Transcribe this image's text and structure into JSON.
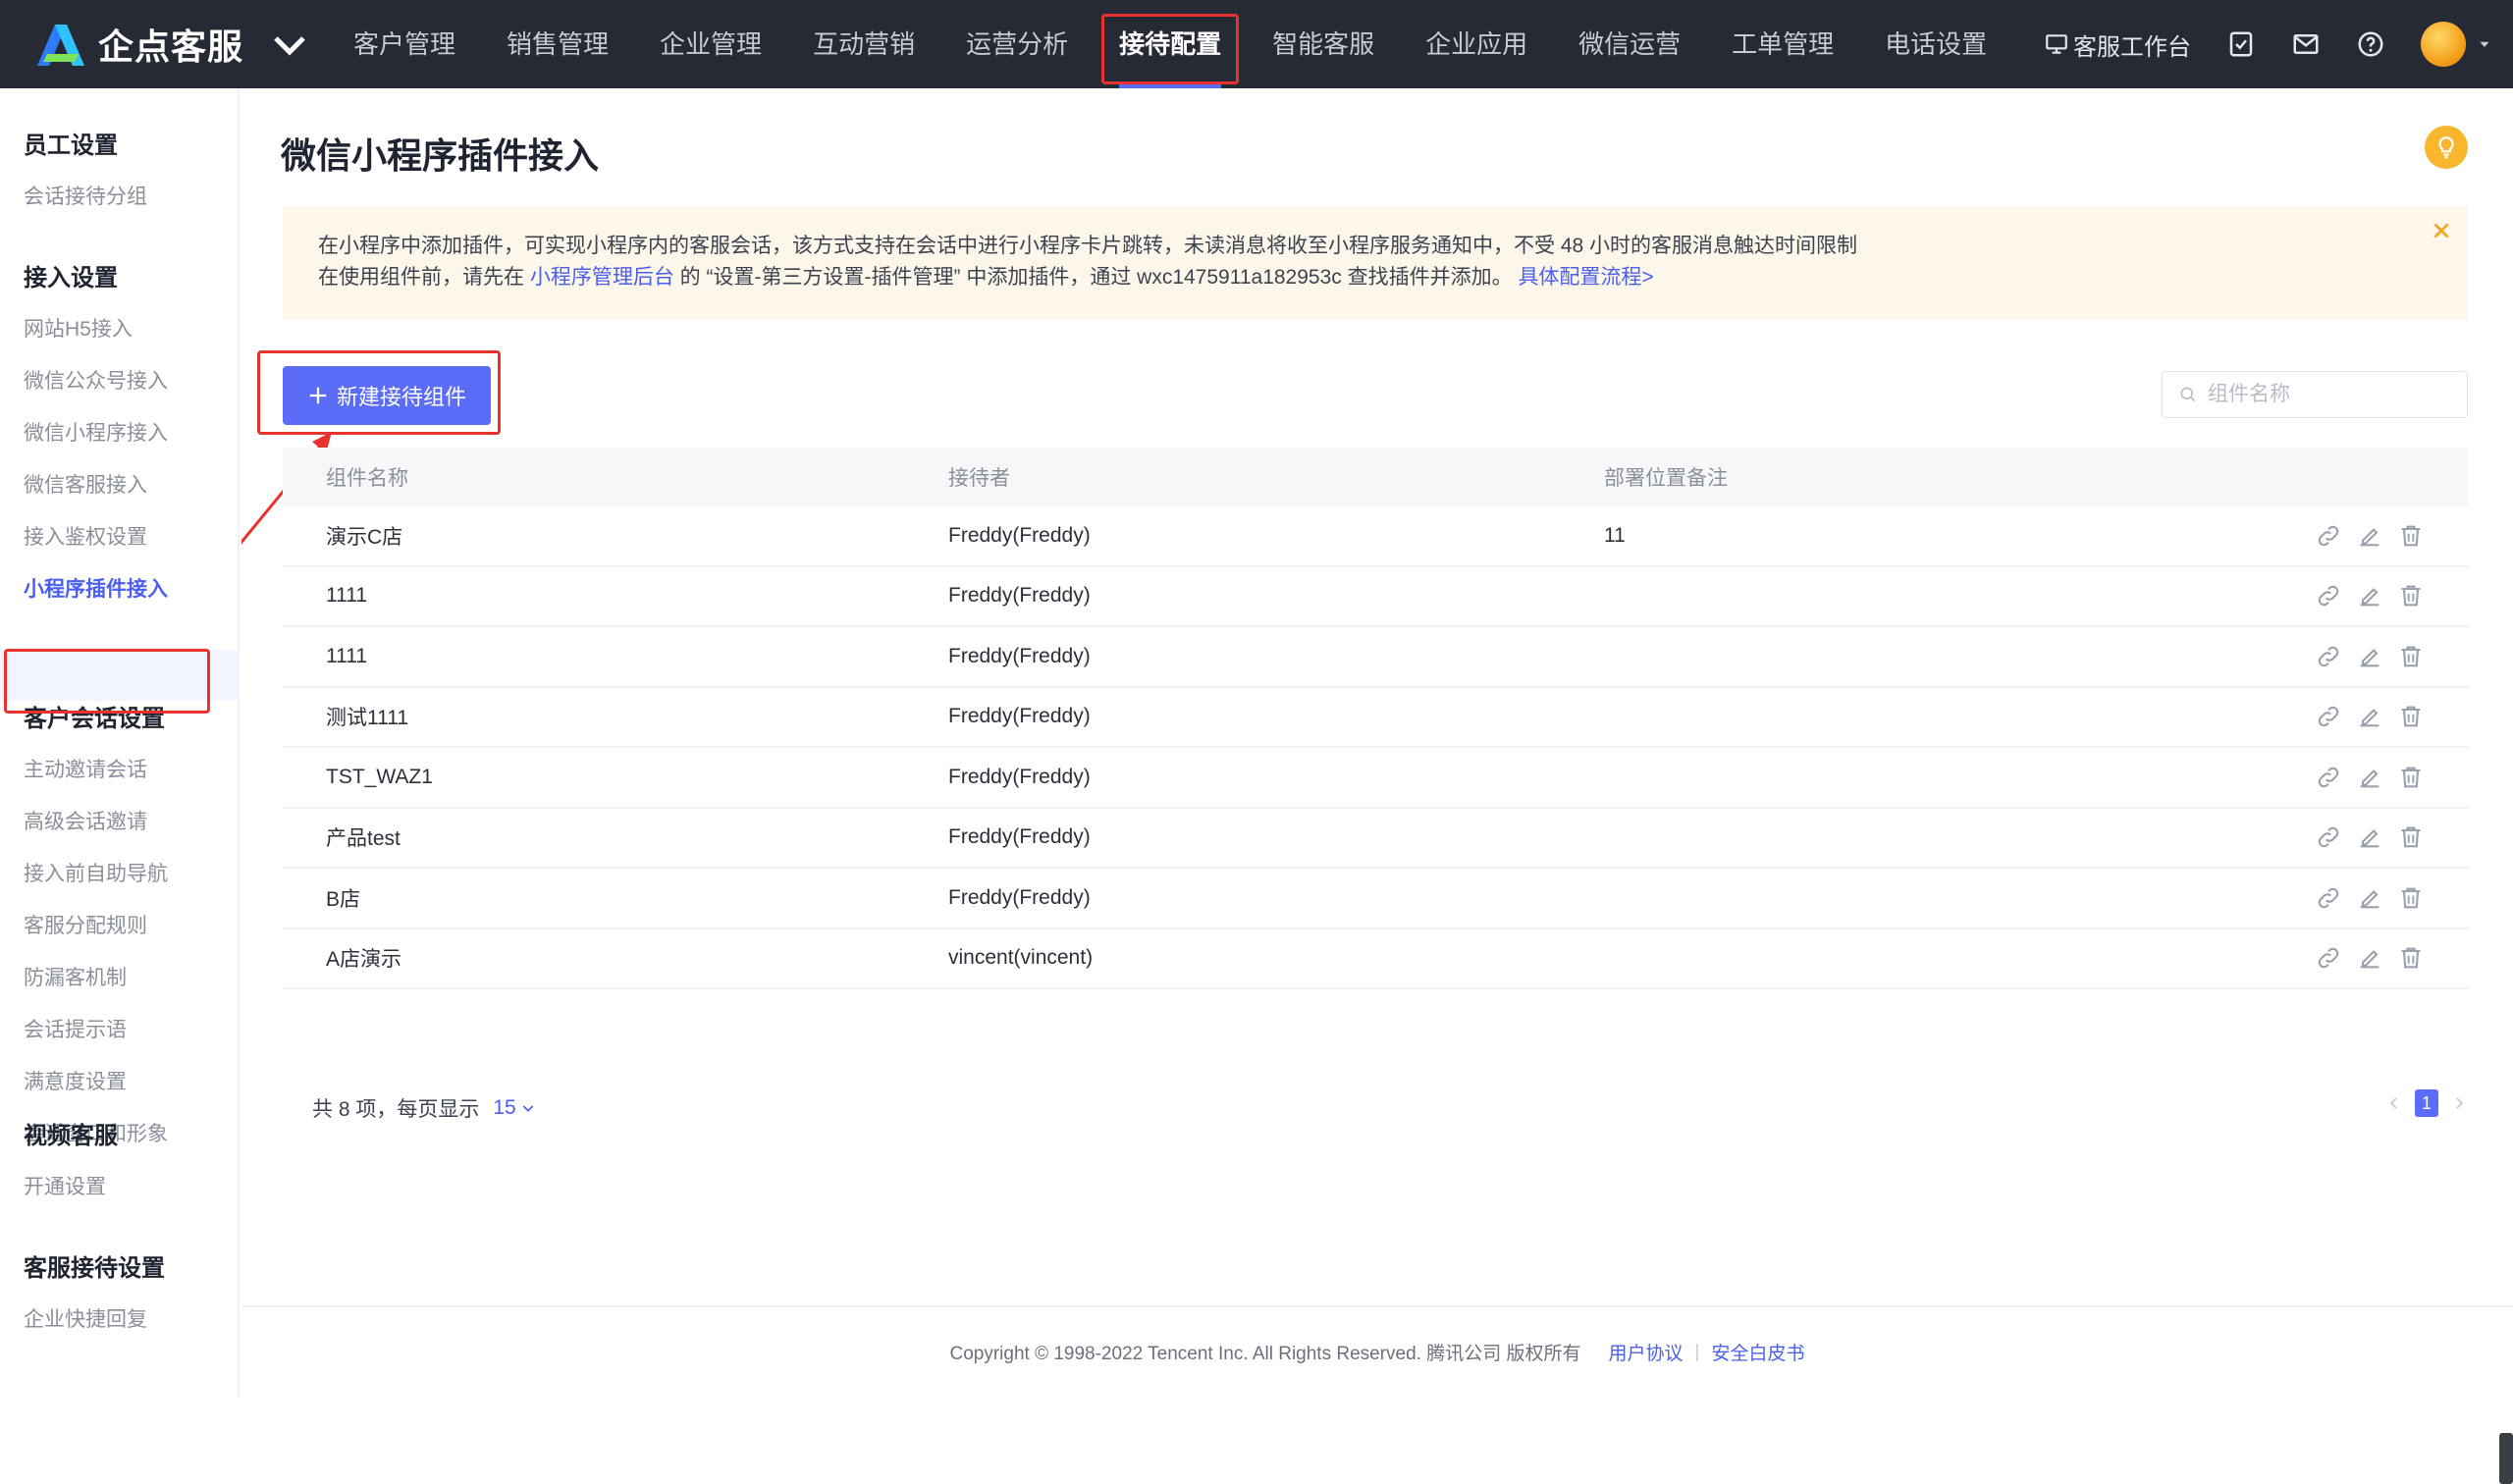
{
  "brand": {
    "name": "企点客服"
  },
  "nav": {
    "items": [
      "客户管理",
      "销售管理",
      "企业管理",
      "互动营销",
      "运营分析",
      "接待配置",
      "智能客服",
      "企业应用",
      "微信运营",
      "工单管理",
      "电话设置"
    ],
    "active": "接待配置"
  },
  "topright": {
    "workbench": "客服工作台"
  },
  "sidebar": {
    "groups": [
      {
        "title": "员工设置",
        "items": [
          "会话接待分组"
        ]
      },
      {
        "title": "接入设置",
        "items": [
          "网站H5接入",
          "微信公众号接入",
          "微信小程序接入",
          "微信客服接入",
          "接入鉴权设置",
          "小程序插件接入"
        ]
      },
      {
        "title": "客户会话设置",
        "items": [
          "主动邀请会话",
          "高级会话邀请",
          "接入前自助导航",
          "客服分配规则",
          "防漏客机制",
          "会话提示语",
          "满意度设置",
          "会话窗口和形象"
        ]
      },
      {
        "title": "视频客服",
        "items": [
          "开通设置"
        ]
      },
      {
        "title": "客服接待设置",
        "items": [
          "企业快捷回复"
        ]
      }
    ],
    "active": "小程序插件接入"
  },
  "page": {
    "title": "微信小程序插件接入",
    "notice": {
      "line1": "在小程序中添加插件，可实现小程序内的客服会话，该方式支持在会话中进行小程序卡片跳转，未读消息将收至小程序服务通知中，不受 48 小时的客服消息触达时间限制",
      "line2_pre": "在使用组件前，请先在 ",
      "line2_link": "小程序管理后台",
      "line2_mid": " 的 “设置-第三方设置-插件管理” 中添加插件，通过 wxc1475911a182953c 查找插件并添加。 ",
      "line2_link2": "具体配置流程>"
    },
    "new_button": "新建接待组件",
    "search_placeholder": "组件名称"
  },
  "table": {
    "columns": [
      "组件名称",
      "接待者",
      "部署位置备注"
    ],
    "rows": [
      {
        "name": "演示C店",
        "receiver": "Freddy(Freddy)",
        "note": "11"
      },
      {
        "name": "1111",
        "receiver": "Freddy(Freddy)",
        "note": ""
      },
      {
        "name": "1111",
        "receiver": "Freddy(Freddy)",
        "note": ""
      },
      {
        "name": "测试1111",
        "receiver": "Freddy(Freddy)",
        "note": ""
      },
      {
        "name": "TST_WAZ1",
        "receiver": "Freddy(Freddy)",
        "note": ""
      },
      {
        "name": "产品test",
        "receiver": "Freddy(Freddy)",
        "note": ""
      },
      {
        "name": "B店",
        "receiver": "Freddy(Freddy)",
        "note": ""
      },
      {
        "name": "A店演示",
        "receiver": "vincent(vincent)",
        "note": ""
      }
    ]
  },
  "pagination": {
    "total_text": "共 8 项，每页显示",
    "page_size": "15",
    "current_page": "1"
  },
  "footer": {
    "copyright": "Copyright © 1998-2022 Tencent Inc. All Rights Reserved. 腾讯公司 版权所有",
    "link1": "用户协议",
    "link2": "安全白皮书"
  },
  "colors": {
    "accent": "#5b6cf9",
    "topbar": "#262a35",
    "highlight": "#e8322d",
    "notice_bg": "#fdf6ea"
  }
}
